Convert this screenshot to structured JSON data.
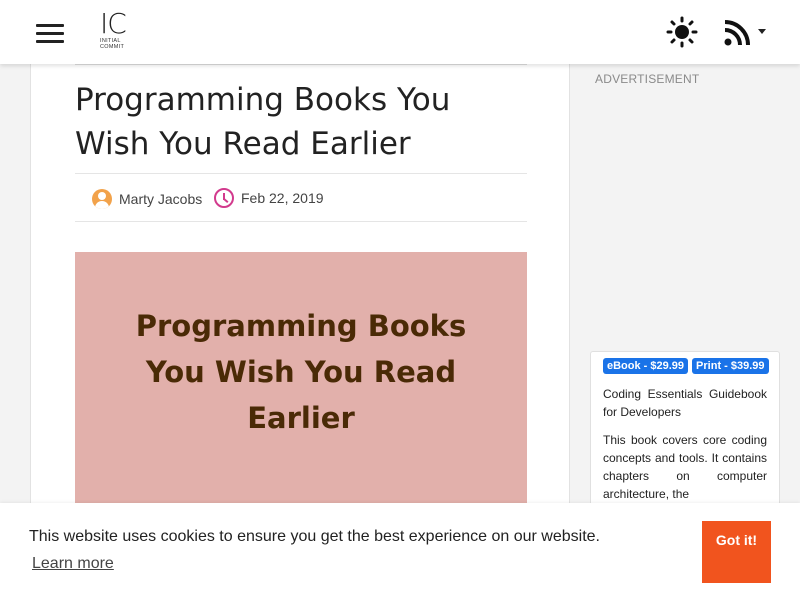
{
  "header": {
    "logo_mark": "IC",
    "logo_line1": "INITIAL",
    "logo_line2": "COMMIT",
    "menu_icon": "hamburger-menu-icon",
    "theme_icon": "sun-icon",
    "feed_icon": "rss-icon"
  },
  "article": {
    "title": "Programming Books You Wish You Read Earlier",
    "author": "Marty Jacobs",
    "date": "Feb 22, 2019",
    "hero_text": "Programming Books You Wish You Read Earlier",
    "hero_color": "#e2b0ab"
  },
  "sidebar": {
    "ad_label": "ADVERTISEMENT",
    "book": {
      "ebook_badge": "eBook - $29.99",
      "print_badge": "Print - $39.99",
      "title": "Coding Essentials Guidebook for Developers",
      "description": "This book covers core coding concepts and tools. It contains chapters on computer architecture, the"
    },
    "badge_color": "#1a73e8"
  },
  "cookie_banner": {
    "message": "This website uses cookies to ensure you get the best experience on our website.",
    "learn_more": "Learn more",
    "accept_label": "Got it!",
    "accept_color": "#f1541e"
  }
}
